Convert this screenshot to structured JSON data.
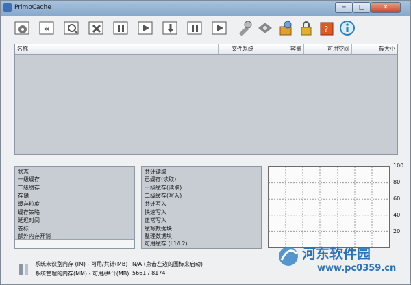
{
  "window": {
    "title": "PrimoCache"
  },
  "window_controls": {
    "minimize": "─",
    "maximize": "□",
    "close": "✕"
  },
  "toolbar": {
    "buttons": [
      {
        "name": "new-cache-task-icon"
      },
      {
        "name": "defer-write-settings-icon"
      },
      {
        "name": "check-icon"
      },
      {
        "name": "delete-icon"
      },
      {
        "name": "pause-icon"
      },
      {
        "name": "resume-icon"
      },
      {
        "name": "flush-icon"
      },
      {
        "name": "pause-all-icon"
      },
      {
        "name": "resume-all-icon"
      },
      {
        "name": "tools-icon"
      },
      {
        "name": "options-icon"
      },
      {
        "name": "gear-box-icon"
      },
      {
        "name": "lock-icon"
      },
      {
        "name": "help-icon"
      },
      {
        "name": "info-icon"
      }
    ]
  },
  "volumes": {
    "headers": {
      "name": "名称",
      "filesystem": "文件系统",
      "capacity": "容量",
      "free": "可用空间",
      "cluster": "簇大小"
    }
  },
  "left_panel": {
    "rows": [
      "状态",
      "一级缓存",
      "二级缓存",
      "存储",
      "缓存粒度",
      "缓存策略",
      "延迟时间",
      "卷标",
      "额外内存开销"
    ]
  },
  "mid_panel": {
    "rows": [
      "共计读取",
      "已缓存(读取)",
      "一级缓存(读取)",
      "二级缓存(写入)",
      "共计写入",
      "快速写入",
      "正常写入",
      "缓写数据块",
      "整理数据块",
      "可用缓存 (L1/L2)"
    ]
  },
  "chart_data": {
    "type": "line",
    "y_ticks": [
      "100",
      "80",
      "60",
      "40",
      "20"
    ],
    "ylim": [
      0,
      100
    ],
    "grid": true,
    "series": []
  },
  "bottom": {
    "line1_label": "系统未识别内存 (IM) - 可用/共计(MB)",
    "line1_value": "N/A (点击左边的图标来启动)",
    "line2_label": "系统管理的内存(MM) - 可用/共计(MB)",
    "line2_value": "5661 / 8174"
  },
  "watermark": {
    "text": "河东软件园",
    "url": "www.pc0359.cn"
  }
}
